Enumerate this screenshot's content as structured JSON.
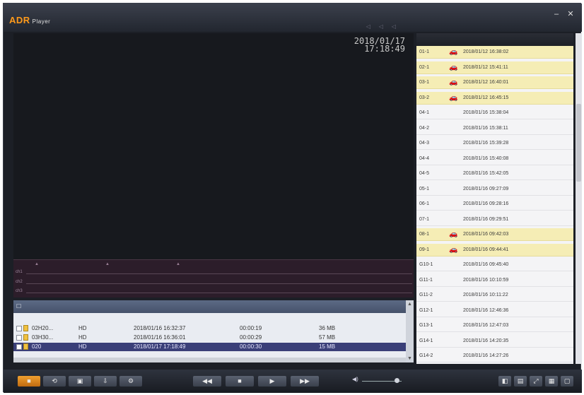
{
  "app": {
    "logo": "ADR",
    "logo_sub": "Player",
    "minimize": "–",
    "close": "✕"
  },
  "video": {
    "date": "2018/01/17",
    "time": "17:18:49"
  },
  "file_table": {
    "rows": [
      {
        "name": "02H20...",
        "quality": "HD",
        "datetime": "2018/01/16 16:32:37",
        "duration": "00:00:19",
        "size": "36 MB",
        "selected": false
      },
      {
        "name": "03H30...",
        "quality": "HD",
        "datetime": "2018/01/16 16:36:01",
        "duration": "00:00:29",
        "size": "57 MB",
        "selected": false
      },
      {
        "name": "020",
        "quality": "HD",
        "datetime": "2018/01/17 17:18:49",
        "duration": "00:00:30",
        "size": "15 MB",
        "selected": true
      }
    ]
  },
  "right_list": {
    "rows": [
      {
        "id": "01-1",
        "time": "2018/01/12 16:38:02",
        "icon": "car-y",
        "hl": true
      },
      {
        "id": "02-1",
        "time": "2018/01/12 15:41:11",
        "icon": "car-g",
        "hl": true
      },
      {
        "id": "03-1",
        "time": "2018/01/12 16:40:01",
        "icon": "car-y",
        "hl": true
      },
      {
        "id": "03-2",
        "time": "2018/01/12 16:45:15",
        "icon": "car-y",
        "hl": true
      },
      {
        "id": "04-1",
        "time": "2018/01/16 15:38:04",
        "icon": "",
        "hl": false
      },
      {
        "id": "04-2",
        "time": "2018/01/16 15:38:11",
        "icon": "",
        "hl": false
      },
      {
        "id": "04-3",
        "time": "2018/01/16 15:39:28",
        "icon": "",
        "hl": false
      },
      {
        "id": "04-4",
        "time": "2018/01/16 15:40:08",
        "icon": "",
        "hl": false
      },
      {
        "id": "04-5",
        "time": "2018/01/16 15:42:05",
        "icon": "",
        "hl": false
      },
      {
        "id": "05-1",
        "time": "2018/01/16 09:27:09",
        "icon": "",
        "hl": false
      },
      {
        "id": "06-1",
        "time": "2018/01/16 09:28:16",
        "icon": "",
        "hl": false
      },
      {
        "id": "07-1",
        "time": "2018/01/16 09:29:51",
        "icon": "",
        "hl": false
      },
      {
        "id": "08-1",
        "time": "2018/01/16 09:42:03",
        "icon": "car-y",
        "hl": true
      },
      {
        "id": "09-1",
        "time": "2018/01/16 09:44:41",
        "icon": "car-g",
        "hl": true
      },
      {
        "id": "G10-1",
        "time": "2018/01/16 09:45:40",
        "icon": "",
        "hl": false
      },
      {
        "id": "G11-1",
        "time": "2018/01/16 10:10:59",
        "icon": "",
        "hl": false
      },
      {
        "id": "G11-2",
        "time": "2018/01/16 10:11:22",
        "icon": "",
        "hl": false
      },
      {
        "id": "G12-1",
        "time": "2018/01/16 12:46:36",
        "icon": "",
        "hl": false
      },
      {
        "id": "G13-1",
        "time": "2018/01/16 12:47:03",
        "icon": "",
        "hl": false
      },
      {
        "id": "G14-1",
        "time": "2018/01/16 14:20:35",
        "icon": "",
        "hl": false
      },
      {
        "id": "G14-2",
        "time": "2018/01/16 14:27:26",
        "icon": "",
        "hl": false
      }
    ]
  },
  "controls": {
    "record": "■",
    "snapshot": "⟲",
    "save": "▣",
    "settings": "⚙",
    "rewind": "◀◀",
    "stop": "■",
    "play": "▶",
    "fast_forward": "▶▶",
    "volume_icon": "◀)",
    "layout_icons": [
      "◧",
      "▤",
      "⤢",
      "▦",
      "▢"
    ]
  }
}
